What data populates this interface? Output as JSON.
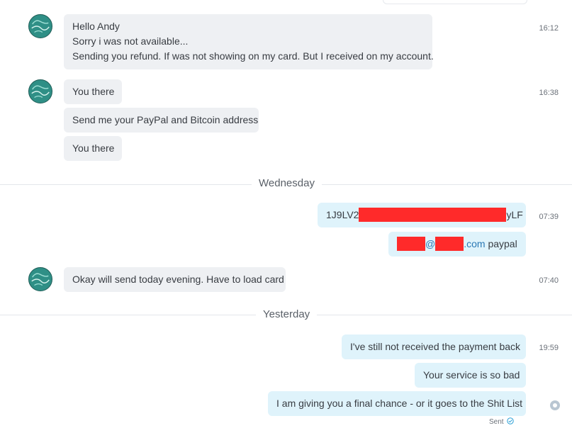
{
  "messages": {
    "m1": {
      "lines": [
        "Hello Andy",
        "Sorry i was not available...",
        "Sending you refund. If was not showing on my card. But I received on my account."
      ],
      "time": "16:12"
    },
    "m2": {
      "text": "You there",
      "time": "16:38"
    },
    "m3": {
      "text": "Send me your PayPal and Bitcoin address"
    },
    "m4": {
      "text": "You there"
    },
    "m5": {
      "prefix": "1J9LV2",
      "suffix": "yLF",
      "time": "07:39"
    },
    "m6": {
      "at": "@",
      "domain": ".com",
      "suffix": " paypal"
    },
    "m7": {
      "text": "Okay will send today evening. Have to load card",
      "time": "07:40"
    },
    "m8": {
      "text": "I've still not received the payment back",
      "time": "19:59"
    },
    "m9": {
      "text": "Your service is so bad"
    },
    "m10": {
      "text": "I am giving you a final chance - or it goes to the Shit List",
      "status": "Sent"
    }
  },
  "separators": {
    "day1": "Wednesday",
    "day2": "Yesterday"
  },
  "colors": {
    "incoming_bubble": "#eef0f3",
    "outgoing_bubble": "#dff3fb",
    "redaction": "#ff2a2a",
    "avatar": "#2f8f86"
  },
  "icons": {
    "avatar": "contact-avatar-icon",
    "sent_check": "check-circle-icon",
    "read_dot": "status-dot-icon"
  }
}
